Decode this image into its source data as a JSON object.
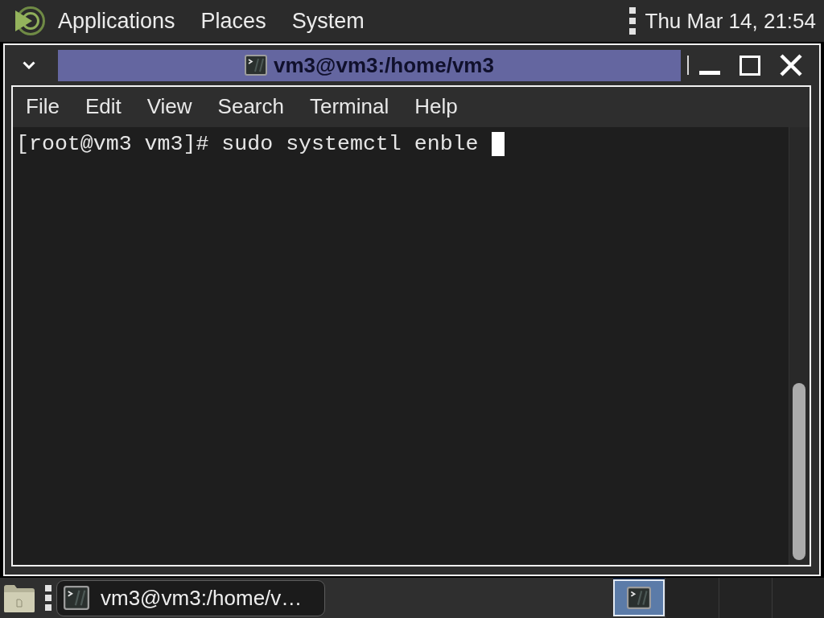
{
  "top_panel": {
    "menus": [
      "Applications",
      "Places",
      "System"
    ],
    "clock": "Thu Mar 14, 21:54"
  },
  "window": {
    "title": "vm3@vm3:/home/vm3",
    "menu_bar": [
      "File",
      "Edit",
      "View",
      "Search",
      "Terminal",
      "Help"
    ],
    "terminal": {
      "lines": [
        "[root@vm3 vm3]# sudo systemctl enble"
      ]
    }
  },
  "bottom_panel": {
    "tasks": [
      {
        "label": "vm3@vm3:/home/v…",
        "selected": true
      }
    ],
    "workspaces": [
      {
        "selected": true,
        "has_window": true
      },
      {
        "selected": false,
        "has_window": false
      },
      {
        "selected": false,
        "has_window": false
      },
      {
        "selected": false,
        "has_window": false
      }
    ]
  }
}
